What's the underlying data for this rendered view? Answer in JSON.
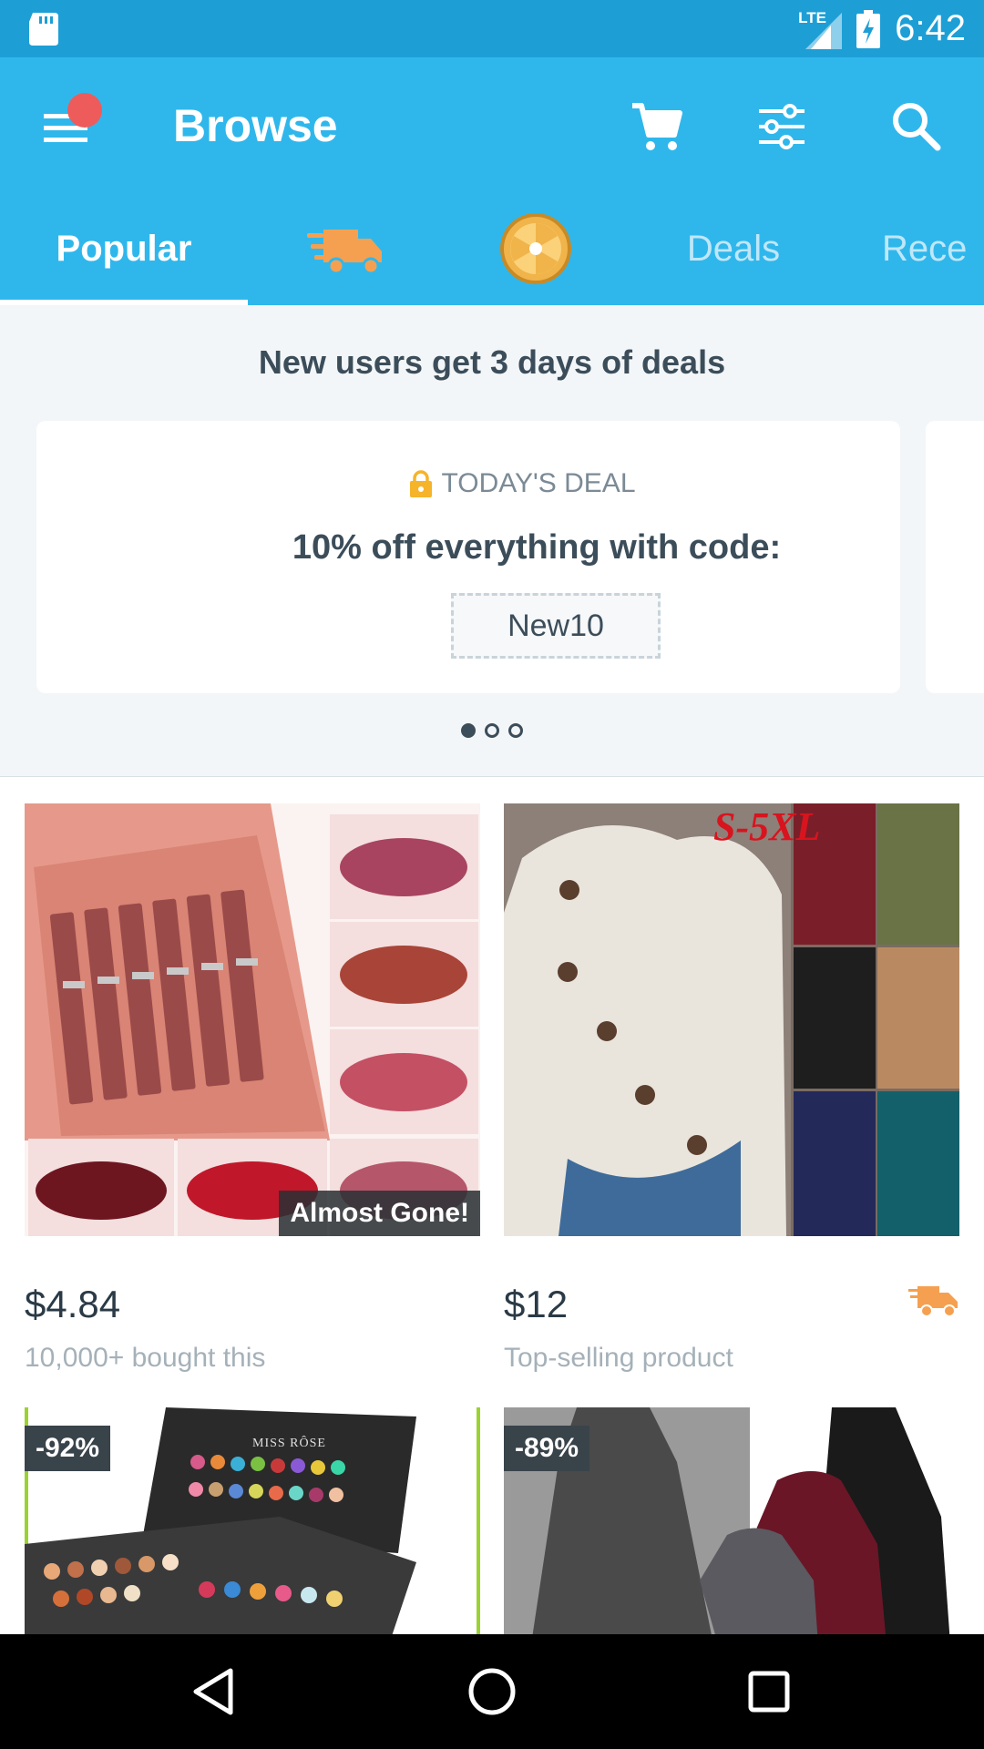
{
  "status_bar": {
    "network": "LTE",
    "time": "6:42",
    "icons": [
      "sd-card-icon",
      "signal-icon",
      "battery-charging-icon"
    ]
  },
  "app_bar": {
    "title": "Browse",
    "icons": [
      "menu-icon",
      "cart-icon",
      "filter-icon",
      "search-icon"
    ],
    "notification_dot_color": "#ee5b5b"
  },
  "tabs": [
    {
      "label": "Popular",
      "active": true
    },
    {
      "label": "",
      "icon": "express-truck-icon"
    },
    {
      "label": "",
      "icon": "daily-spin-icon"
    },
    {
      "label": "Deals"
    },
    {
      "label": "Rece"
    }
  ],
  "deal_banner": {
    "heading": "New users get 3 days of deals",
    "label": "TODAY'S DEAL",
    "text": "10% off everything with code:",
    "code": "New10",
    "carousel_pages": 3,
    "active_page": 0
  },
  "products": [
    {
      "price": "$4.84",
      "subtitle": "10,000+ bought this",
      "badge": "Almost Gone!",
      "image": "lipstick-set-image"
    },
    {
      "price": "$12",
      "subtitle": "Top-selling product",
      "image_text": "S-5XL",
      "image": "sweater-image",
      "express": true
    },
    {
      "badge": "-92%",
      "image_text": "MISS RÔSE",
      "image": "eyeshadow-palette-image"
    },
    {
      "badge": "-89%",
      "image": "turtleneck-dress-image"
    }
  ],
  "colors": {
    "status_bar": "#1d9fd6",
    "app_bar": "#2fb7ec",
    "accent_orange": "#f5a050",
    "text_dark": "#3c4d5a"
  }
}
